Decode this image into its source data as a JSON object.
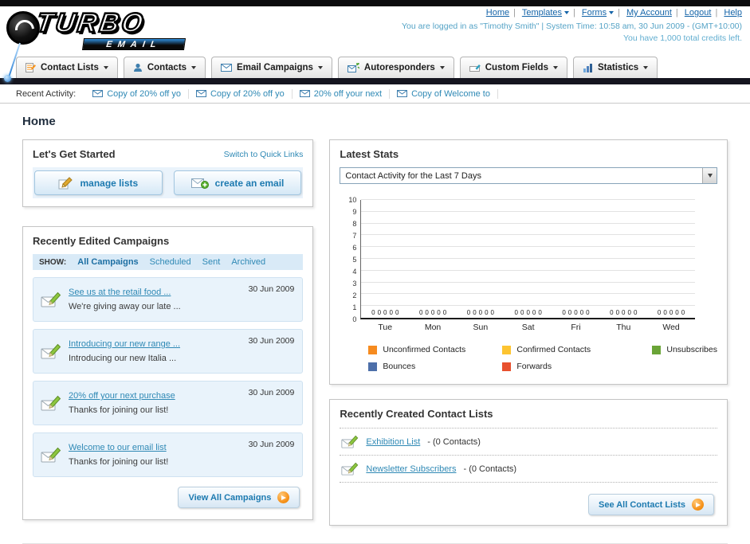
{
  "header": {
    "logo_line1": "TURBO",
    "logo_line2": "EMAIL",
    "top_links": [
      "Home",
      "Templates",
      "Forms",
      "My Account",
      "Logout",
      "Help"
    ],
    "login_status": "You are logged in as \"Timothy Smith\" | System Time: 10:58 am, 30 Jun 2009 - (GMT+10:00)",
    "credits": "You have 1,000 total credits left."
  },
  "nav": {
    "tabs": [
      {
        "label": "Contact Lists"
      },
      {
        "label": "Contacts"
      },
      {
        "label": "Email Campaigns"
      },
      {
        "label": "Autoresponders"
      },
      {
        "label": "Custom Fields"
      },
      {
        "label": "Statistics"
      }
    ]
  },
  "recent_activity": {
    "label": "Recent Activity:",
    "items": [
      "Copy of 20% off yo",
      "Copy of 20% off yo",
      "20% off your next",
      "Copy of Welcome to"
    ]
  },
  "page_title": "Home",
  "get_started": {
    "title": "Let's Get Started",
    "switch_link": "Switch to Quick Links",
    "manage_lists_label": "manage lists",
    "create_email_label": "create an email"
  },
  "campaigns": {
    "title": "Recently Edited Campaigns",
    "show_label": "SHOW:",
    "filters": [
      "All Campaigns",
      "Scheduled",
      "Sent",
      "Archived"
    ],
    "active_filter": "All Campaigns",
    "items": [
      {
        "title": "See us at the retail food ...",
        "subtitle": "We're giving away our late ...",
        "date": "30 Jun 2009"
      },
      {
        "title": "Introducing our new range ...",
        "subtitle": "Introducing our new Italia ...",
        "date": "30 Jun 2009"
      },
      {
        "title": "20% off your next purchase",
        "subtitle": "Thanks for joining our list!",
        "date": "30 Jun 2009"
      },
      {
        "title": "Welcome to our email list",
        "subtitle": "Thanks for joining our list!",
        "date": "30 Jun 2009"
      }
    ],
    "view_all_label": "View All Campaigns"
  },
  "stats": {
    "title": "Latest Stats",
    "period_selector": "Contact Activity for the Last 7 Days",
    "chart_data": {
      "type": "bar",
      "title": "Contact Activity for the Last 7 Days",
      "categories": [
        "Tue",
        "Mon",
        "Sun",
        "Sat",
        "Fri",
        "Thu",
        "Wed"
      ],
      "series": [
        {
          "name": "Unconfirmed Contacts",
          "color": "#f68b1f",
          "values": [
            0,
            0,
            0,
            0,
            0,
            0,
            0
          ]
        },
        {
          "name": "Confirmed Contacts",
          "color": "#fdc431",
          "values": [
            0,
            0,
            0,
            0,
            0,
            0,
            0
          ]
        },
        {
          "name": "Unsubscribes",
          "color": "#6aa437",
          "values": [
            0,
            0,
            0,
            0,
            0,
            0,
            0
          ]
        },
        {
          "name": "Bounces",
          "color": "#4d6fa9",
          "values": [
            0,
            0,
            0,
            0,
            0,
            0,
            0
          ]
        },
        {
          "name": "Forwards",
          "color": "#e8502e",
          "values": [
            0,
            0,
            0,
            0,
            0,
            0,
            0
          ]
        }
      ],
      "xlabel": "",
      "ylabel": "",
      "ylim": [
        0,
        10
      ],
      "yticks": [
        0,
        1,
        2,
        3,
        4,
        5,
        6,
        7,
        8,
        9,
        10
      ],
      "grid": true,
      "legend_position": "bottom"
    }
  },
  "contact_lists": {
    "title": "Recently Created Contact Lists",
    "items": [
      {
        "name": "Exhibition List",
        "detail": "- (0 Contacts)"
      },
      {
        "name": "Newsletter Subscribers",
        "detail": "- (0 Contacts)"
      }
    ],
    "see_all_label": "See All Contact Lists"
  }
}
